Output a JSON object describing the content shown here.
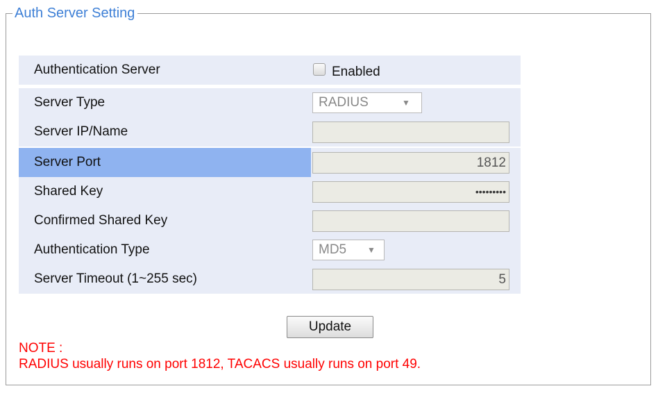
{
  "panel": {
    "legend": "Auth Server Setting"
  },
  "rows": [
    {
      "label": "Authentication Server",
      "checkbox_label": "Enabled",
      "checked": false
    },
    {
      "label": "Server Type",
      "select_value": "RADIUS"
    },
    {
      "label": "Server IP/Name",
      "value": ""
    },
    {
      "label": "Server Port",
      "value": "1812",
      "selected": true
    },
    {
      "label": "Shared Key",
      "value": "•••••••••"
    },
    {
      "label": "Confirmed Shared Key",
      "value": ""
    },
    {
      "label": "Authentication Type",
      "select_value": "MD5"
    },
    {
      "label": "Server Timeout (1~255 sec)",
      "value": "5"
    }
  ],
  "actions": {
    "update_label": "Update"
  },
  "note": {
    "title": "NOTE :",
    "text": "RADIUS usually runs on port 1812, TACACS usually runs on port 49."
  },
  "icons": {
    "dropdown_caret": "▼"
  },
  "colors": {
    "legend": "#3d7fd6",
    "row_bg": "#e8ecf7",
    "row_selected": "#8fb3f0",
    "note": "#ff0000"
  }
}
